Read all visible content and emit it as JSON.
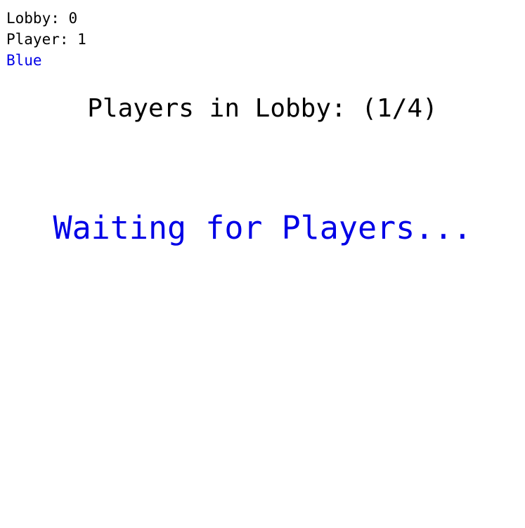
{
  "hud": {
    "lobby_text": "Lobby: 0",
    "player_text": "Player: 1",
    "team_color_name": "Blue"
  },
  "lobby_status": {
    "players_text": "Players in Lobby: (1/4)"
  },
  "message": {
    "waiting_text": "Waiting for Players..."
  },
  "colors": {
    "text": "#000000",
    "accent_blue": "#0000e6",
    "background": "#ffffff"
  }
}
